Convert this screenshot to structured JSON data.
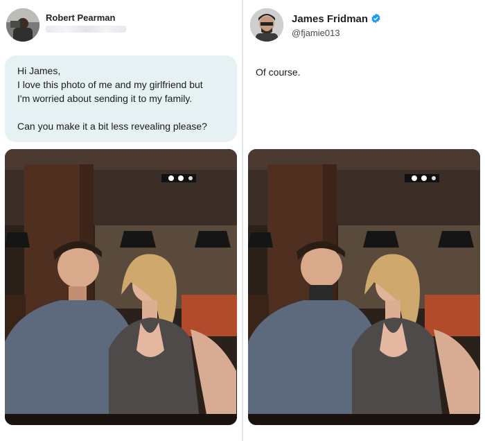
{
  "left": {
    "user_name": "Robert Pearman",
    "message_lines": [
      "Hi James,",
      "I love this photo of me and my girlfriend but",
      "I'm worried about sending it to my family.",
      "",
      "Can you make it a bit less revealing please?"
    ],
    "avatar_icon": "profile-photo",
    "handle_redacted": true
  },
  "right": {
    "user_name": "James Fridman",
    "handle": "@fjamie013",
    "verified": true,
    "reply": "Of course.",
    "avatar_icon": "profile-photo"
  },
  "colors": {
    "bubble": "#e6f1f4",
    "verified_blue": "#1d9bf0",
    "divider": "#e6e6e6"
  }
}
